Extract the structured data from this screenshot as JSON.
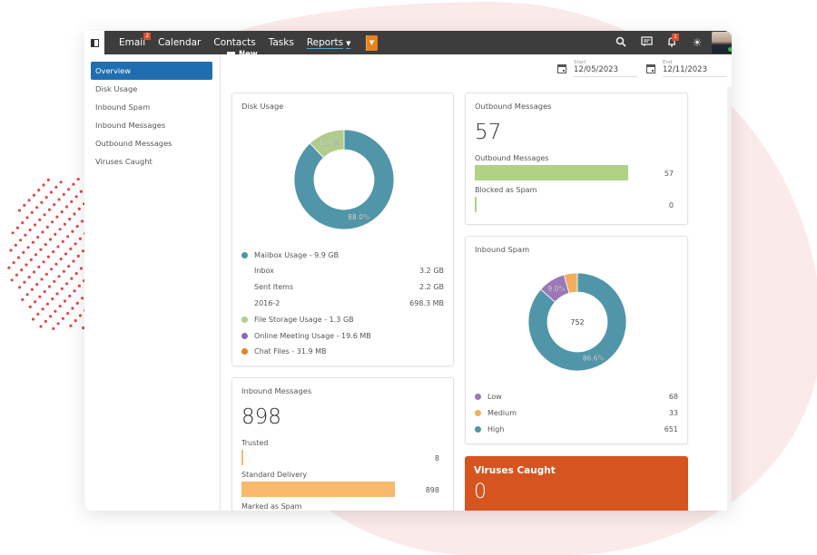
{
  "topbar": {
    "nav": [
      {
        "label": "Email",
        "badge": "2"
      },
      {
        "label": "Calendar"
      },
      {
        "label": "Contacts"
      },
      {
        "label": "Tasks"
      },
      {
        "label": "Reports",
        "active": true
      }
    ],
    "new_button_label": "New",
    "notification_badge": "1"
  },
  "sidebar": {
    "items": [
      {
        "label": "Overview",
        "active": true
      },
      {
        "label": "Disk Usage"
      },
      {
        "label": "Inbound Spam"
      },
      {
        "label": "Inbound Messages"
      },
      {
        "label": "Outbound Messages"
      },
      {
        "label": "Viruses Caught"
      }
    ]
  },
  "dates": {
    "start_label": "Start",
    "start_value": "12/05/2023",
    "end_label": "End",
    "end_value": "12/11/2023"
  },
  "disk_usage": {
    "title": "Disk Usage",
    "slices": [
      {
        "name": "Mailbox Usage",
        "percent": 88.0,
        "color": "#5096a8",
        "label": "88.0%"
      },
      {
        "name": "File Storage Usage",
        "percent": 12.0,
        "color": "#b1cd8e",
        "label": "12.0%"
      }
    ],
    "legend": [
      {
        "label": "Mailbox Usage - 9.9 GB",
        "color": "#4e96a8"
      },
      {
        "label": "Inbox",
        "value": "3.2 GB",
        "sub": true
      },
      {
        "label": "Sent Items",
        "value": "2.2 GB",
        "sub": true
      },
      {
        "label": "2016-2",
        "value": "698.3 MB",
        "sub": true
      },
      {
        "label": "File Storage Usage - 1.3 GB",
        "color": "#b1cd8e"
      },
      {
        "label": "Online Meeting Usage - 19.6 MB",
        "color": "#8e69b0"
      },
      {
        "label": "Chat Files - 31.9 MB",
        "color": "#e8821c"
      }
    ]
  },
  "outbound": {
    "title": "Outbound Messages",
    "total": "57",
    "bars": [
      {
        "label": "Outbound Messages",
        "value": "57",
        "fraction": 1.0,
        "color": "#b1d184"
      },
      {
        "label": "Blocked as Spam",
        "value": "0",
        "fraction": 0.0,
        "color": "#b1d184"
      }
    ]
  },
  "inbound_spam": {
    "title": "Inbound Spam",
    "center_label": "752",
    "slices": [
      {
        "name": "High",
        "percent": 86.6,
        "color": "#5096a8",
        "label": "86.6%"
      },
      {
        "name": "Low",
        "percent": 9.0,
        "color": "#9b78b8",
        "label": "9.0%"
      },
      {
        "name": "Medium",
        "percent": 4.4,
        "color": "#f2ae5e",
        "label": ""
      }
    ],
    "legend": [
      {
        "label": "Low",
        "value": "68",
        "color": "#9b78b8"
      },
      {
        "label": "Medium",
        "value": "33",
        "color": "#f2ae5e"
      },
      {
        "label": "High",
        "value": "651",
        "color": "#4e96a8"
      }
    ]
  },
  "inbound_messages": {
    "title": "Inbound Messages",
    "total": "898",
    "bars": [
      {
        "label": "Trusted",
        "value": "8",
        "fraction": 0.009,
        "color": "#f9b96c"
      },
      {
        "label": "Standard Delivery",
        "value": "898",
        "fraction": 1.0,
        "color": "#f9b96c"
      },
      {
        "label": "Marked as Spam",
        "value": "",
        "fraction": 0,
        "color": "#f9b96c"
      }
    ]
  },
  "viruses": {
    "title": "Viruses Caught",
    "total": "0",
    "color": "#d6541f"
  }
}
